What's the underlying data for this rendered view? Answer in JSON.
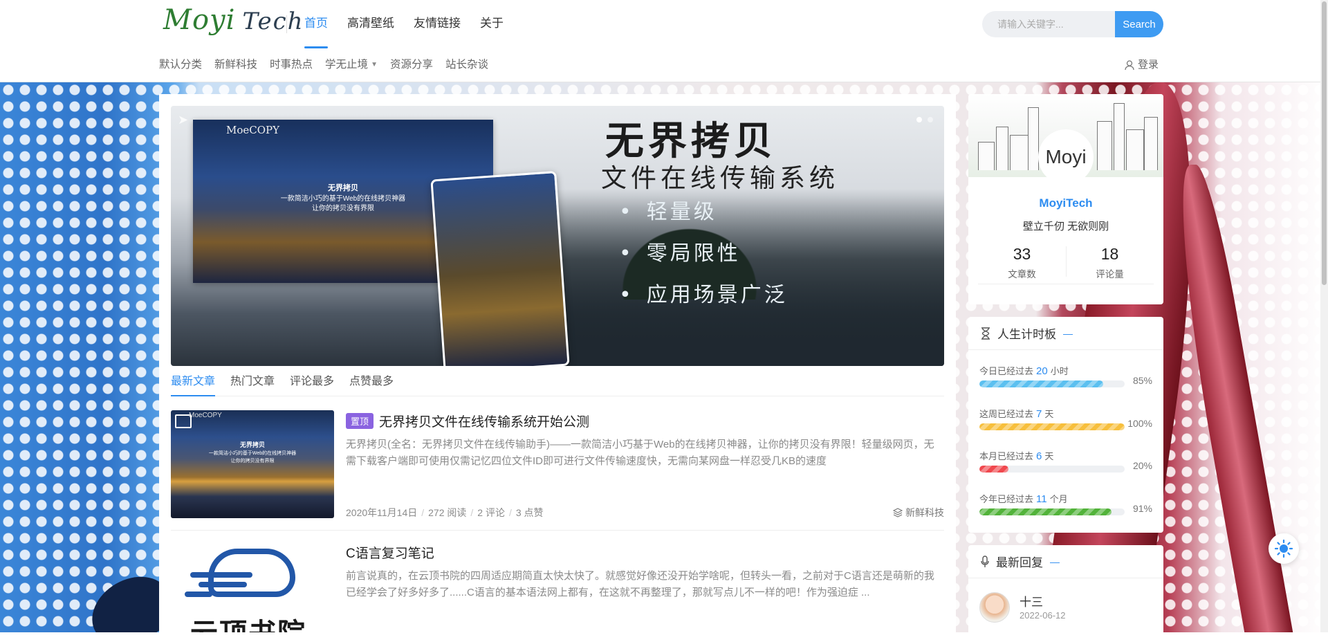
{
  "brand": {
    "logo_a": "Moyi",
    "logo_b": "Tech"
  },
  "nav": {
    "items": [
      "首页",
      "高清壁纸",
      "友情链接",
      "关于"
    ],
    "active": 0
  },
  "search": {
    "placeholder": "请输入关键字...",
    "button": "Search"
  },
  "subnav": {
    "categories": [
      "默认分类",
      "新鲜科技",
      "时事热点",
      "学无止境",
      "资源分享",
      "站长杂谈"
    ],
    "login": "登录"
  },
  "banner": {
    "brand": "MoeCOPY",
    "screen_text": [
      "无界拷贝",
      "一款简洁小巧的基于Web的在线拷贝神器",
      "让你的拷贝没有界限"
    ],
    "headline": "无界拷贝",
    "subheadline": "文件在线传输系统",
    "bullets": [
      "轻量级",
      "零局限性",
      "应用场景广泛"
    ]
  },
  "tabs": [
    "最新文章",
    "热门文章",
    "评论最多",
    "点赞最多"
  ],
  "posts": [
    {
      "tag": "置顶",
      "title": "无界拷贝文件在线传输系统开始公测",
      "excerpt": "无界拷贝(全名：无界拷贝文件在线传输助手)——一款简洁小巧基于Web的在线拷贝神器，让你的拷贝没有界限！轻量级网页，无需下载客户端即可使用仅需记忆四位文件ID即可进行文件传输速度快，无需向某网盘一样忍受几KB的速度",
      "date": "2020年11月14日",
      "views": "272 阅读",
      "comments": "2 评论",
      "likes": "3 点赞",
      "category": "新鲜科技"
    },
    {
      "title": "C语言复习笔记",
      "excerpt": "前言说真的，在云顶书院的四周适应期简直太快太快了。就感觉好像还没开始学啥呢，但转头一看，之前对于C语言还是萌新的我已经学会了好多好多了......C语言的基本语法网上都有，在这就不再整理了，那就写点儿不一样的吧！作为强迫症 ...",
      "thumb_text": "云顶书院"
    }
  ],
  "profile": {
    "avatar_text": "Moyi",
    "name": "MoyiTech",
    "motto": "壁立千仞 无欲则刚",
    "stats": [
      {
        "value": "33",
        "label": "文章数"
      },
      {
        "value": "18",
        "label": "评论量"
      }
    ]
  },
  "timer": {
    "title": "人生计时板",
    "rows": [
      {
        "prefix": "今日已经过去",
        "value": "20",
        "unit": "小时",
        "percent": 85,
        "percent_label": "85%",
        "color": "#5bc0f0"
      },
      {
        "prefix": "这周已经过去",
        "value": "7",
        "unit": "天",
        "percent": 100,
        "percent_label": "100%",
        "color": "#f7bf3c"
      },
      {
        "prefix": "本月已经过去",
        "value": "6",
        "unit": "天",
        "percent": 20,
        "percent_label": "20%",
        "color": "#f0484e"
      },
      {
        "prefix": "今年已经过去",
        "value": "11",
        "unit": "个月",
        "percent": 91,
        "percent_label": "91%",
        "color": "#52b33a"
      }
    ]
  },
  "replies": {
    "title": "最新回复",
    "items": [
      {
        "name": "十三",
        "date": "2022-06-12"
      }
    ]
  },
  "icons": {
    "login": "user-icon",
    "timer": "hourglass-icon",
    "replies": "microphone-icon",
    "category": "layers-icon",
    "theme": "sun-icon"
  },
  "colors": {
    "accent": "#2d8cf0",
    "search_button": "#3e9bf2",
    "sticky_tag": "#8a63e0"
  }
}
